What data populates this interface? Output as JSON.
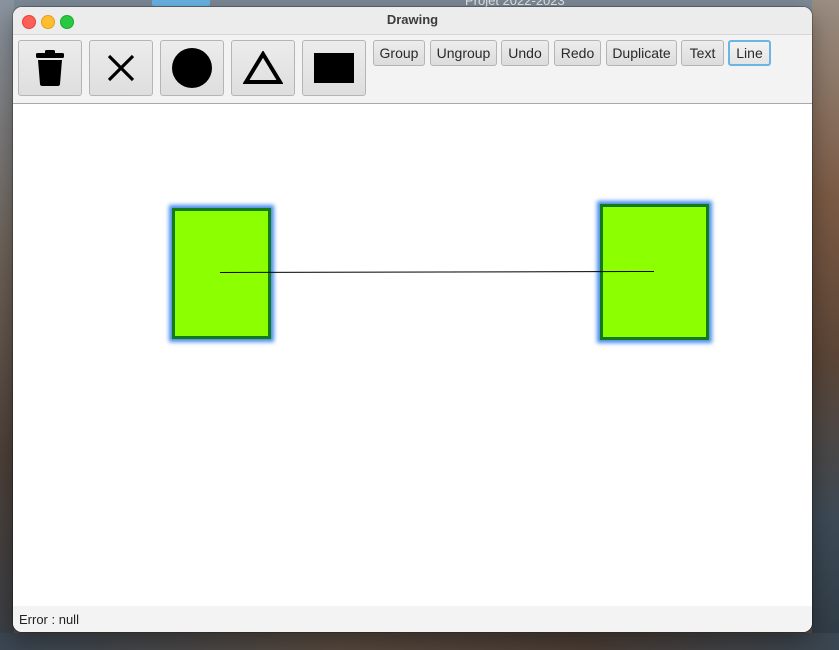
{
  "desktop": {
    "background_text": "Projet 2022-2023"
  },
  "window": {
    "title": "Drawing"
  },
  "toolbar": {
    "icon_buttons": [
      {
        "icon": "trash-icon"
      },
      {
        "icon": "close-icon"
      },
      {
        "icon": "circle-icon"
      },
      {
        "icon": "triangle-icon"
      },
      {
        "icon": "rectangle-icon"
      }
    ],
    "group_label": "Group",
    "ungroup_label": "Ungroup",
    "undo_label": "Undo",
    "redo_label": "Redo",
    "duplicate_label": "Duplicate",
    "text_label": "Text",
    "line_label": "Line",
    "selected_tool": "Line"
  },
  "canvas": {
    "shapes": [
      {
        "type": "rectangle",
        "fill": "#8cff00",
        "stroke": "#137a1b",
        "selected": true
      },
      {
        "type": "rectangle",
        "fill": "#8cff00",
        "stroke": "#137a1b",
        "selected": true
      },
      {
        "type": "line",
        "stroke": "#000000"
      }
    ]
  },
  "status": {
    "text": "Error : null"
  },
  "colors": {
    "accent_focus": "#6cb4e4",
    "selection_glow": "#2878e6"
  }
}
